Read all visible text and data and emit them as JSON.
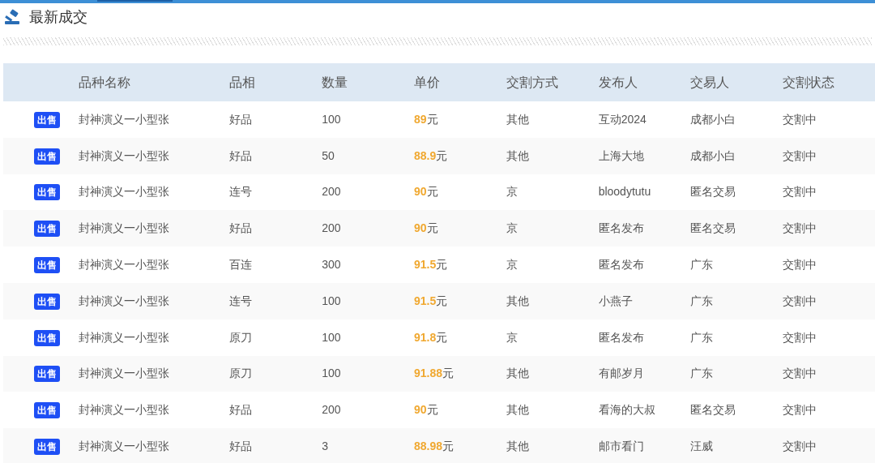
{
  "title": "最新成交",
  "table": {
    "columns": [
      "品种名称",
      "品相",
      "数量",
      "单价",
      "交割方式",
      "发布人",
      "交易人",
      "交割状态"
    ],
    "rows": [
      {
        "tag": "出售",
        "name": "封神演义一小型张",
        "grade": "好品",
        "qty": "100",
        "price": "89",
        "unit": "元",
        "method": "其他",
        "publisher": "互动2024",
        "trader": "成都小白",
        "status": "交割中"
      },
      {
        "tag": "出售",
        "name": "封神演义一小型张",
        "grade": "好品",
        "qty": "50",
        "price": "88.9",
        "unit": "元",
        "method": "其他",
        "publisher": "上海大地",
        "trader": "成都小白",
        "status": "交割中"
      },
      {
        "tag": "出售",
        "name": "封神演义一小型张",
        "grade": "连号",
        "qty": "200",
        "price": "90",
        "unit": "元",
        "method": "京",
        "publisher": "bloodytutu",
        "trader": "匿名交易",
        "status": "交割中"
      },
      {
        "tag": "出售",
        "name": "封神演义一小型张",
        "grade": "好品",
        "qty": "200",
        "price": "90",
        "unit": "元",
        "method": "京",
        "publisher": "匿名发布",
        "trader": "匿名交易",
        "status": "交割中"
      },
      {
        "tag": "出售",
        "name": "封神演义一小型张",
        "grade": "百连",
        "qty": "300",
        "price": "91.5",
        "unit": "元",
        "method": "京",
        "publisher": "匿名发布",
        "trader": "广东",
        "status": "交割中"
      },
      {
        "tag": "出售",
        "name": "封神演义一小型张",
        "grade": "连号",
        "qty": "100",
        "price": "91.5",
        "unit": "元",
        "method": "其他",
        "publisher": "小燕子",
        "trader": "广东",
        "status": "交割中"
      },
      {
        "tag": "出售",
        "name": "封神演义一小型张",
        "grade": "原刀",
        "qty": "100",
        "price": "91.8",
        "unit": "元",
        "method": "京",
        "publisher": "匿名发布",
        "trader": "广东",
        "status": "交割中"
      },
      {
        "tag": "出售",
        "name": "封神演义一小型张",
        "grade": "原刀",
        "qty": "100",
        "price": "91.88",
        "unit": "元",
        "method": "其他",
        "publisher": "有邮岁月",
        "trader": "广东",
        "status": "交割中"
      },
      {
        "tag": "出售",
        "name": "封神演义一小型张",
        "grade": "好品",
        "qty": "200",
        "price": "90",
        "unit": "元",
        "method": "其他",
        "publisher": "看海的大叔",
        "trader": "匿名交易",
        "status": "交割中"
      },
      {
        "tag": "出售",
        "name": "封神演义一小型张",
        "grade": "好品",
        "qty": "3",
        "price": "88.98",
        "unit": "元",
        "method": "其他",
        "publisher": "邮市看门",
        "trader": "汪威",
        "status": "交割中"
      }
    ]
  }
}
